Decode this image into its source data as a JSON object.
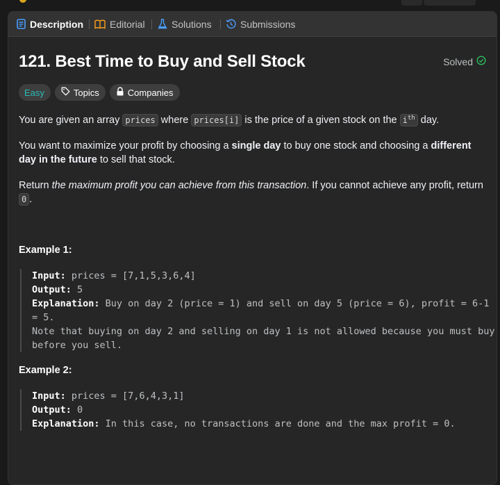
{
  "tabs": [
    {
      "label": "Description",
      "icon": "description-icon",
      "active": true
    },
    {
      "label": "Editorial",
      "icon": "book-icon",
      "active": false
    },
    {
      "label": "Solutions",
      "icon": "flask-icon",
      "active": false
    },
    {
      "label": "Submissions",
      "icon": "history-icon",
      "active": false
    }
  ],
  "problem": {
    "title": "121. Best Time to Buy and Sell Stock",
    "status": "Solved",
    "difficulty": "Easy",
    "topics_label": "Topics",
    "companies_label": "Companies"
  },
  "description": {
    "p1": {
      "t1": "You are given an array ",
      "c1": "prices",
      "t2": " where ",
      "c2": "prices[i]",
      "t3": " is the price of a given stock on the ",
      "c3_base": "i",
      "c3_sup": "th",
      "t4": " day."
    },
    "p2": {
      "t1": "You want to maximize your profit by choosing a ",
      "b1": "single day",
      "t2": " to buy one stock and choosing a ",
      "b2": "different day in the future",
      "t3": " to sell that stock."
    },
    "p3": {
      "t1": "Return ",
      "i1": "the maximum profit you can achieve from this transaction",
      "t2": ". If you cannot achieve any profit, return ",
      "c1": "0",
      "t3": "."
    }
  },
  "examples": [
    {
      "title": "Example 1:",
      "input_label": "Input:",
      "input": " prices = [7,1,5,3,6,4]",
      "output_label": "Output:",
      "output": " 5",
      "explanation_label": "Explanation:",
      "explanation": " Buy on day 2 (price = 1) and sell on day 5 (price = 6), profit = 6-1 = 5.\nNote that buying on day 2 and selling on day 1 is not allowed because you must buy before you sell."
    },
    {
      "title": "Example 2:",
      "input_label": "Input:",
      "input": " prices = [7,6,4,3,1]",
      "output_label": "Output:",
      "output": " 0",
      "explanation_label": "Explanation:",
      "explanation": " In this case, no transactions are done and the max profit = 0."
    }
  ],
  "colors": {
    "accent_blue": "#4a9eff",
    "easy": "#2cbbb5",
    "solved": "#2cbb5d",
    "editorial": "#ffa116"
  }
}
